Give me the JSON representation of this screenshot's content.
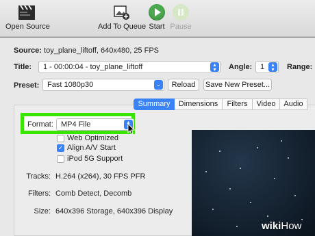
{
  "toolbar": {
    "open_source": "Open Source",
    "add_to_queue": "Add To Queue",
    "start": "Start",
    "pause": "Pause"
  },
  "source": {
    "label": "Source:",
    "value": "toy_plane_liftoff, 640x480, 25 FPS"
  },
  "title_row": {
    "label": "Title:",
    "value": "1 - 00:00:04 - toy_plane_liftoff",
    "angle_label": "Angle:",
    "angle_value": "1",
    "range_label": "Range:"
  },
  "preset_row": {
    "label": "Preset:",
    "value": "Fast 1080p30",
    "reload": "Reload",
    "save_new": "Save New Preset..."
  },
  "tabs": [
    {
      "label": "Summary",
      "active": true
    },
    {
      "label": "Dimensions",
      "active": false
    },
    {
      "label": "Filters",
      "active": false
    },
    {
      "label": "Video",
      "active": false
    },
    {
      "label": "Audio",
      "active": false
    }
  ],
  "format": {
    "label": "Format:",
    "value": "MP4 File"
  },
  "options": [
    {
      "label": "Web Optimized",
      "checked": false
    },
    {
      "label": "Align A/V Start",
      "checked": true
    },
    {
      "label": "iPod 5G Support",
      "checked": false
    }
  ],
  "summary": {
    "tracks_label": "Tracks:",
    "tracks_value": "H.264 (x264), 30 FPS PFR",
    "filters_label": "Filters:",
    "filters_value": "Comb Detect, Decomb",
    "size_label": "Size:",
    "size_value": "640x396 Storage, 640x396 Display"
  },
  "watermark": {
    "wiki": "wiki",
    "how": "How"
  },
  "colors": {
    "accent": "#3a82f7",
    "highlight": "#39e500",
    "start_green": "#4aa84e"
  }
}
